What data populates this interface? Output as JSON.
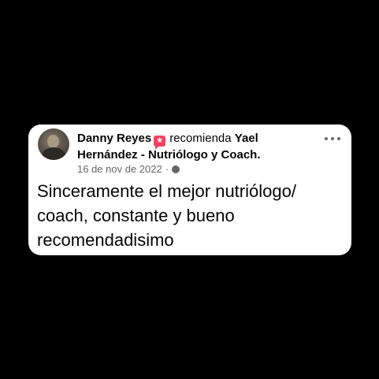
{
  "post": {
    "author": "Danny Reyes",
    "badge_icon": "recommend-star-icon",
    "verb": "recomienda",
    "page_name": "Yael Hernández - Nutriólogo y Coach.",
    "date": "16 de nov de 2022",
    "separator": "·",
    "privacy_icon": "globe-icon",
    "more_icon": "more-options-icon",
    "text": "Sinceramente el mejor nutriólogo/ coach, constante y bueno recomendadisimo"
  },
  "colors": {
    "background": "#000000",
    "card": "#ffffff",
    "badge": "#f3425f",
    "meta_text": "#65676b"
  }
}
